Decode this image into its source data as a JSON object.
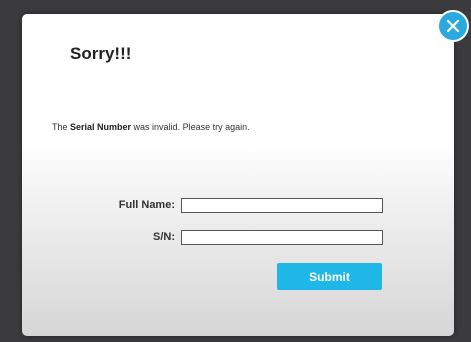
{
  "dialog": {
    "title": "Sorry!!!",
    "message_prefix": "The ",
    "message_bold": "Serial Number",
    "message_suffix": " was invalid.  Please try again.",
    "close_icon": "close-icon"
  },
  "form": {
    "full_name_label": "Full Name:",
    "full_name_value": "",
    "sn_label": "S/N:",
    "sn_value": "",
    "submit_label": "Submit"
  },
  "colors": {
    "accent": "#1fb8e6",
    "close_button": "#29a9e0",
    "backdrop": "#3b3b3d"
  }
}
